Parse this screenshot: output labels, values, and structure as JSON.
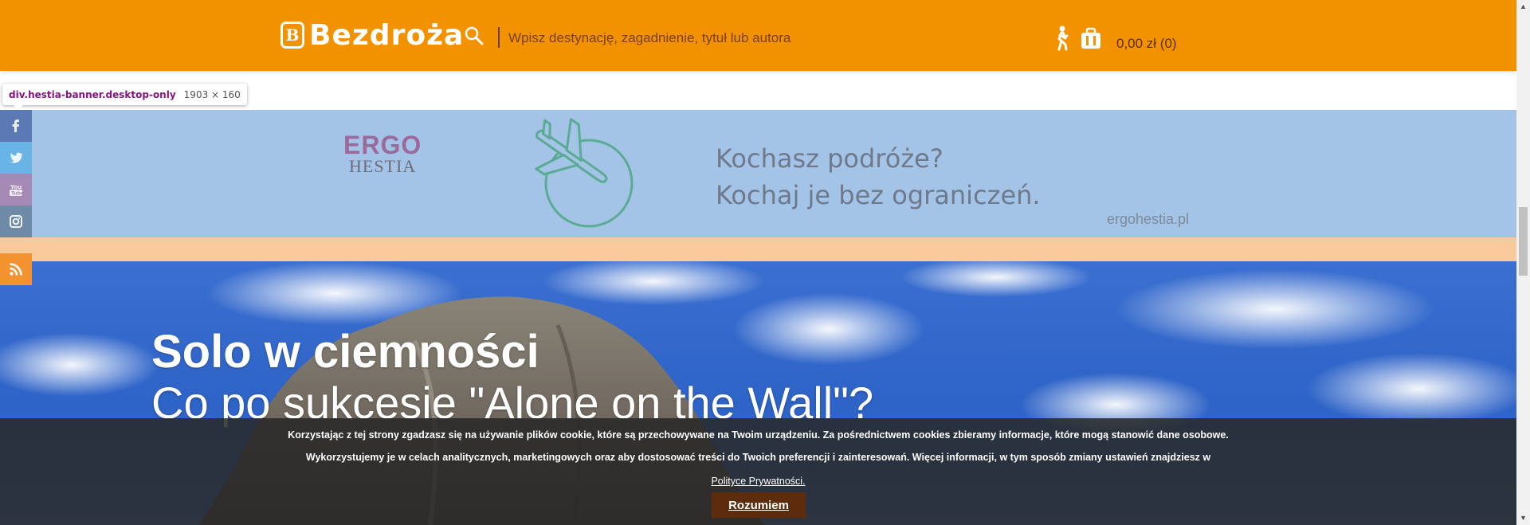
{
  "header": {
    "logo_text": "Bezdroża",
    "search_placeholder": "Wpisz destynację, zagadnienie, tytuł lub autora",
    "cart_text": "0,00 zł (0)"
  },
  "devtools_tooltip": {
    "selector": "div.hestia-banner.desktop-only",
    "size": "1903 × 160"
  },
  "banner": {
    "brand_ergo": "ERGO",
    "brand_hestia": "HESTIA",
    "line1": "Kochasz podróże?",
    "line2": "Kochaj je bez ograniczeń.",
    "url": "ergohestia.pl"
  },
  "hero": {
    "title": "Solo w ciemności",
    "subtitle": "Co po sukcesie \"Alone on the Wall\"?"
  },
  "social": {
    "items": [
      "facebook-icon",
      "twitter-icon",
      "youtube-icon",
      "instagram-icon",
      "rss-icon"
    ],
    "colors": {
      "facebook": "#5b79b4",
      "twitter": "#69b4e6",
      "youtube": "#a589b5",
      "instagram": "#6e8aa6",
      "rss": "#f39330"
    }
  },
  "cookie": {
    "line1": "Korzystając z tej strony zgadzasz się na używanie plików cookie, które są przechowywane na Twoim urządzeniu. Za pośrednictwem cookies zbieramy informacje, które mogą stanowić dane osobowe.",
    "line2": "Wykorzystujemy je w celach analitycznych, marketingowych oraz aby dostosować treści do Twoich preferencji i zainteresowań. Więcej informacji, w tym sposób zmiany ustawień znajdziesz w",
    "link": "Polityce Prywatności.",
    "button": "Rozumiem"
  },
  "colors": {
    "header_bg": "#f39200",
    "banner_bg": "#a3c4e6",
    "cookie_button_bg": "#5c2c0c"
  }
}
